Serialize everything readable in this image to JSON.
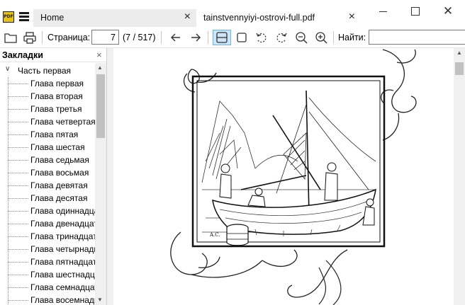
{
  "app": {
    "icon_text": "PDF"
  },
  "tabs": [
    {
      "label": "Home",
      "close": "×"
    },
    {
      "label": "tainstvennyiyi-ostrovi-full.pdf",
      "close": "×"
    }
  ],
  "window": {
    "close": "✕"
  },
  "toolbar": {
    "page_label": "Страница:",
    "page_value": "7",
    "page_count": "(7 / 517)",
    "find_label": "Найти:",
    "find_value": ""
  },
  "sidebar": {
    "title": "Закладки",
    "close": "×",
    "root": {
      "caret": "∨",
      "label": "Часть первая"
    },
    "items": [
      "Глава первая",
      "Глава вторая",
      "Глава третья",
      "Глава четвертая",
      "Глава пятая",
      "Глава шестая",
      "Глава седьмая",
      "Глава восьмая",
      "Глава девятая",
      "Глава десятая",
      "Глава одиннадцатая",
      "Глава двенадцатая",
      "Глава тринадцатая",
      "Глава четырнадцатая",
      "Глава пятнадцатая",
      "Глава шестнадцатая",
      "Глава семнадцатая",
      "Глава восемнадцатая"
    ]
  },
  "document": {
    "illustration": "engraving-boat-with-sailors",
    "signature": "A.C."
  }
}
